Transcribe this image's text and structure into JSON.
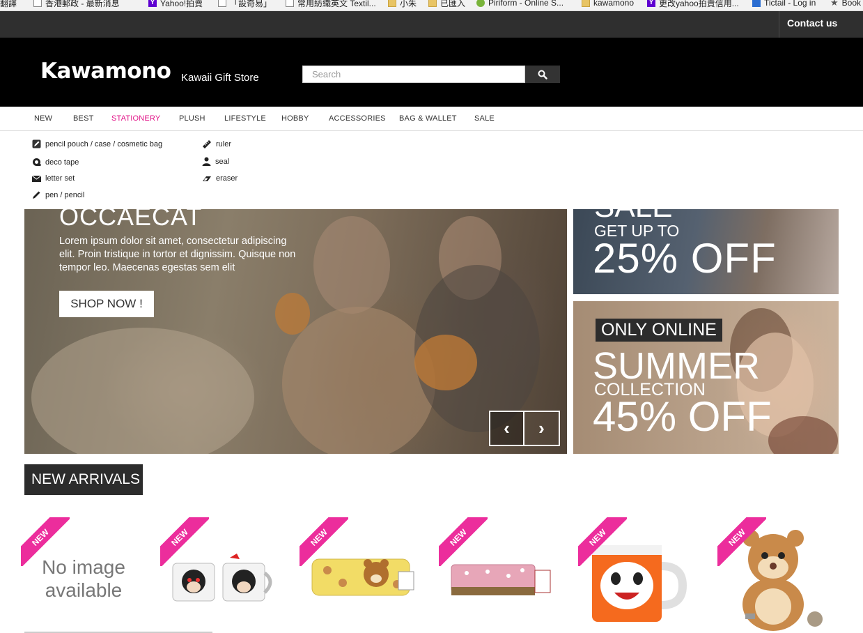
{
  "bookmarks": [
    {
      "label": "翻譯",
      "icon": "translate-icon"
    },
    {
      "label": "香港郵政 - 最新消息",
      "icon": "page-icon"
    },
    {
      "label": "Yahoo!拍賣",
      "icon": "yahoo-icon"
    },
    {
      "label": "「設奇易」",
      "icon": "site-icon"
    },
    {
      "label": "常用紡織英文 Textil...",
      "icon": "page-icon"
    },
    {
      "label": "小朱",
      "icon": "folder-icon"
    },
    {
      "label": "已匯入",
      "icon": "folder-icon"
    },
    {
      "label": "Piriform - Online S...",
      "icon": "piriform-icon"
    },
    {
      "label": "kawamono",
      "icon": "folder-icon"
    },
    {
      "label": "更改yahoo拍賣信用...",
      "icon": "yahoo-icon"
    },
    {
      "label": "Tictail - Log in",
      "icon": "tictail-icon"
    },
    {
      "label": "Book",
      "icon": "star-icon"
    }
  ],
  "topbar": {
    "contact": "Contact us"
  },
  "header": {
    "logo": "Kawamono",
    "tagline": "Kawaii Gift Store",
    "search_placeholder": "Search"
  },
  "nav": {
    "items": [
      "NEW",
      "BEST",
      "STATIONERY",
      "PLUSH",
      "LIFESTYLE",
      "HOBBY",
      "ACCESSORIES",
      "BAG & WALLET",
      "SALE"
    ],
    "active": "STATIONERY"
  },
  "dropdown": {
    "col1": [
      {
        "label": "pencil pouch / case / cosmetic bag",
        "icon": "pencil-square-icon"
      },
      {
        "label": "deco tape",
        "icon": "tape-icon"
      },
      {
        "label": "letter set",
        "icon": "envelope-icon"
      },
      {
        "label": "pen / pencil",
        "icon": "pencil-icon"
      }
    ],
    "col2": [
      {
        "label": "ruler",
        "icon": "ruler-icon"
      },
      {
        "label": "seal",
        "icon": "user-icon"
      },
      {
        "label": "eraser",
        "icon": "eraser-icon"
      }
    ]
  },
  "hero": {
    "title": "OCCAECAT",
    "text": "Lorem ipsum dolor sit amet, consectetur adipiscing elit. Proin tristique in tortor et dignissim. Quisque non tempor leo. Maecenas egestas sem elit",
    "button": "SHOP NOW !",
    "prev_icon": "‹",
    "next_icon": "›"
  },
  "promo1": {
    "sale": "SALE",
    "get_up_to": "GET UP TO",
    "off": "25% OFF"
  },
  "promo2": {
    "badge": "ONLY ONLINE",
    "summer": "SUMMER",
    "collection": "COLLECTION",
    "off": "45% OFF"
  },
  "new_arrivals": {
    "title": "NEW ARRIVALS",
    "ribbon": "NEW",
    "no_image": "No image available",
    "products": [
      "no-image",
      "mickey-mugs",
      "rilakkuma-pencil-case",
      "pink-pencil-pouch",
      "jibanyan-mug",
      "chipmunk-plush"
    ]
  }
}
